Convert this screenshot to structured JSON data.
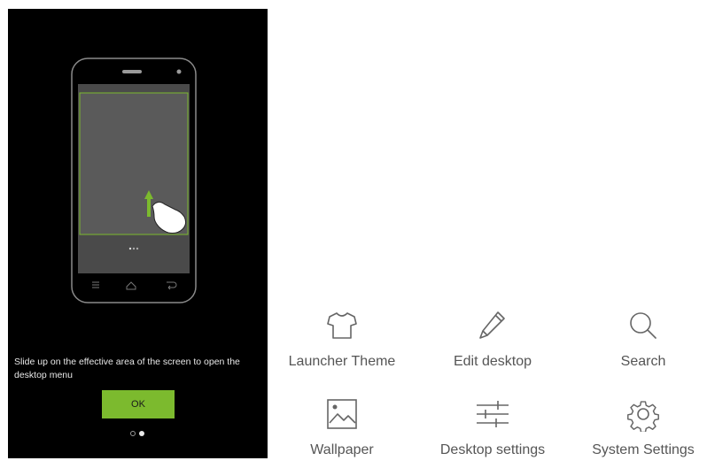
{
  "tutorial": {
    "hint": "Slide up on the effective area of the screen to open the desktop menu",
    "ok_label": "OK",
    "page_count": 2,
    "active_page": 2
  },
  "menu": {
    "items": [
      {
        "label": "Launcher Theme",
        "icon": "shirt-icon"
      },
      {
        "label": "Edit desktop",
        "icon": "pencil-icon"
      },
      {
        "label": "Search",
        "icon": "search-icon"
      },
      {
        "label": "Wallpaper",
        "icon": "image-icon"
      },
      {
        "label": "Desktop settings",
        "icon": "sliders-icon"
      },
      {
        "label": "System Settings",
        "icon": "gear-icon"
      }
    ]
  },
  "colors": {
    "accent": "#7cba2e",
    "panel_bg": "#000000",
    "label": "#555555",
    "icon": "#666666"
  }
}
